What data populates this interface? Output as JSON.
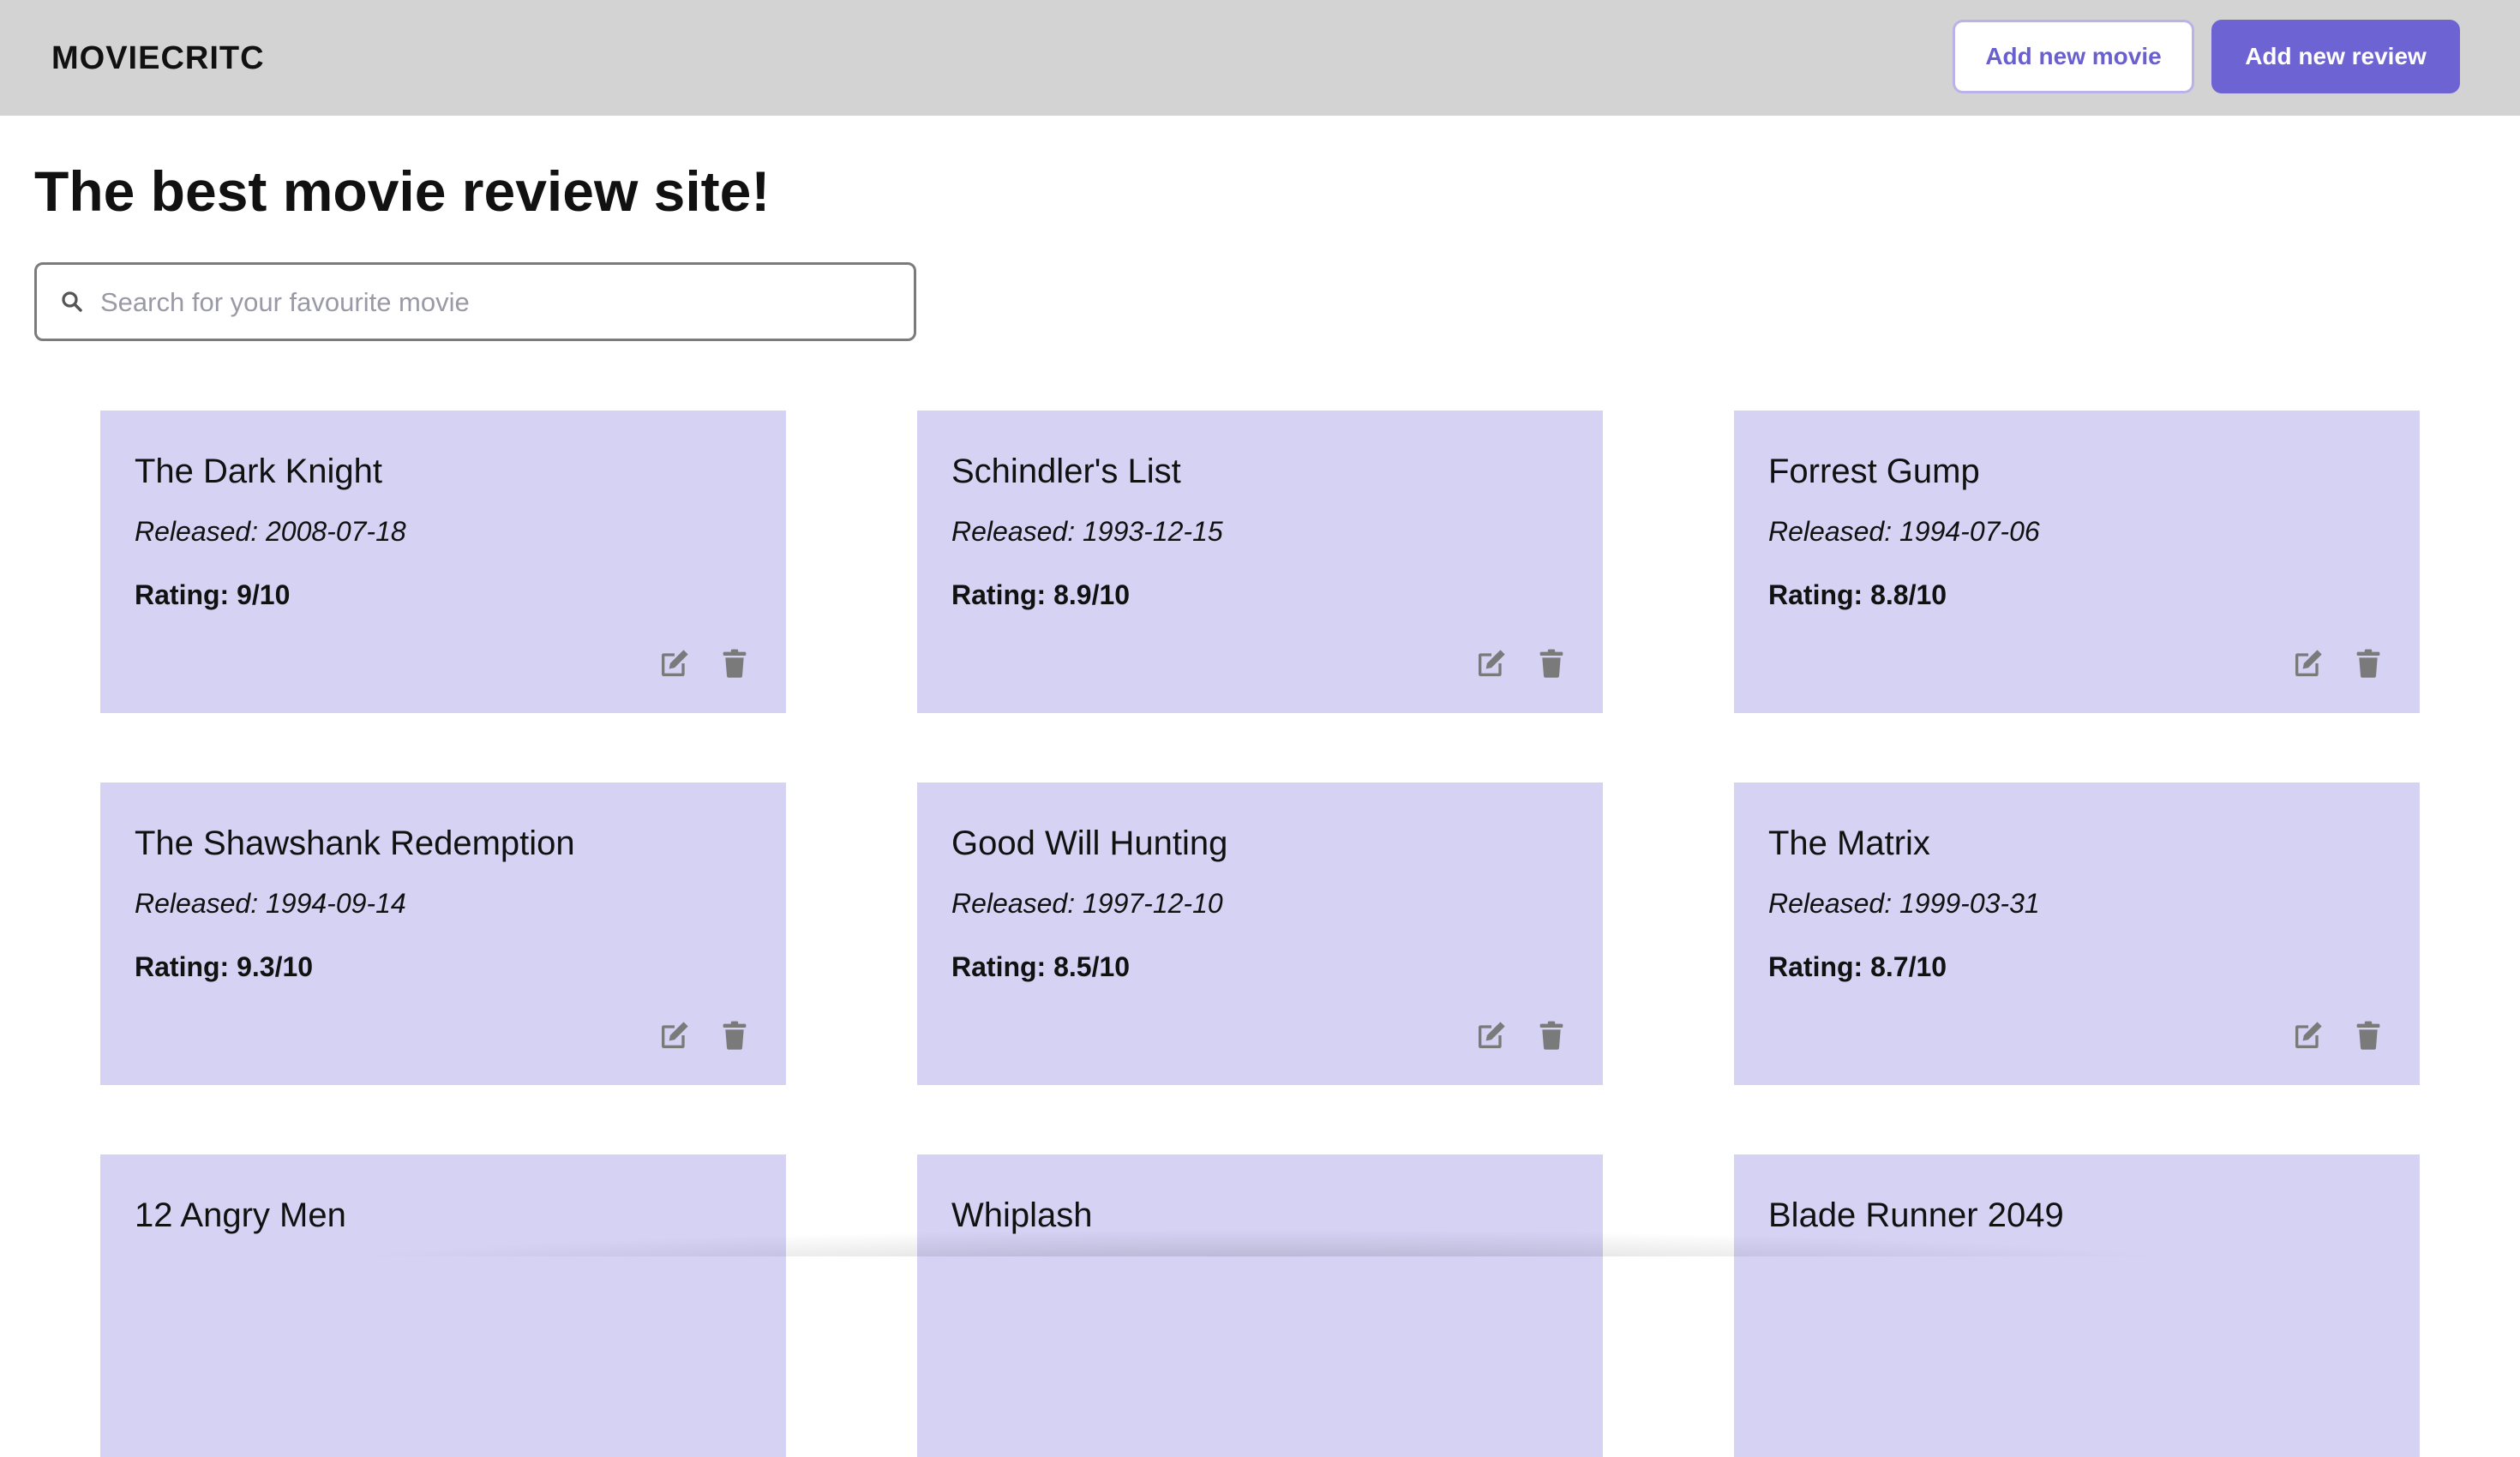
{
  "header": {
    "brand": "MOVIECRITC",
    "add_movie_label": "Add new movie",
    "add_review_label": "Add new review"
  },
  "main": {
    "title": "The best movie review site!",
    "search_placeholder": "Search for your favourite movie",
    "search_value": ""
  },
  "movies": [
    {
      "title": "The Dark Knight",
      "released": "Released: 2008-07-18",
      "rating": "Rating: 9/10"
    },
    {
      "title": "Schindler's List",
      "released": "Released: 1993-12-15",
      "rating": "Rating: 8.9/10"
    },
    {
      "title": "Forrest Gump",
      "released": "Released: 1994-07-06",
      "rating": "Rating: 8.8/10"
    },
    {
      "title": "The Shawshank Redemption",
      "released": "Released: 1994-09-14",
      "rating": "Rating: 9.3/10"
    },
    {
      "title": "Good Will Hunting",
      "released": "Released: 1997-12-10",
      "rating": "Rating: 8.5/10"
    },
    {
      "title": "The Matrix",
      "released": "Released: 1999-03-31",
      "rating": "Rating: 8.7/10"
    },
    {
      "title": "12 Angry Men",
      "released": "",
      "rating": ""
    },
    {
      "title": "Whiplash",
      "released": "",
      "rating": ""
    },
    {
      "title": "Blade Runner 2049",
      "released": "",
      "rating": ""
    }
  ],
  "icons": {
    "search": "search-icon",
    "edit": "edit-icon",
    "delete": "trash-icon"
  },
  "colors": {
    "header_bg": "#d3d3d3",
    "accent": "#6e63d3",
    "card_bg": "#d5d2f4",
    "icon": "#7a7a7a"
  }
}
